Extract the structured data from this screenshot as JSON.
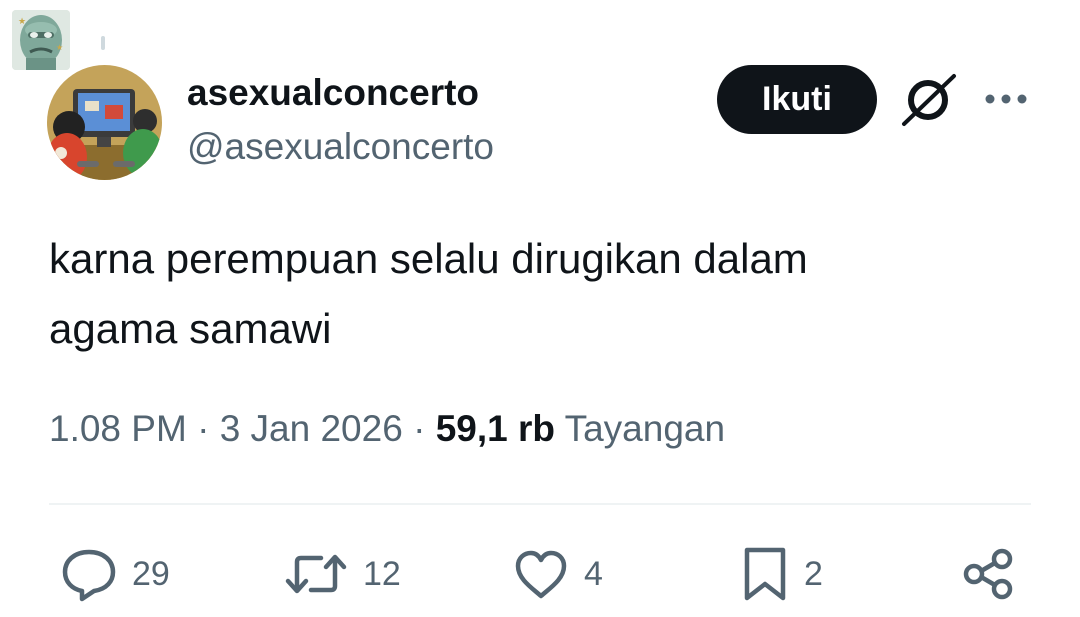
{
  "author": {
    "display_name": "asexualconcerto",
    "handle": "@asexualconcerto"
  },
  "header": {
    "follow_label": "Ikuti",
    "grok_icon": "grok-slash-circle-icon",
    "more_icon": "more-dots-icon"
  },
  "tweet": {
    "text": "karna perempuan selalu dirugikan dalam\nagama samawi",
    "time": "1.08 PM",
    "separator": "·",
    "date": "3 Jan 2026",
    "views_count": "59,1 rb",
    "views_label": "Tayangan"
  },
  "actions": {
    "reply_count": "29",
    "retweet_count": "12",
    "like_count": "4",
    "bookmark_count": "2"
  },
  "colors": {
    "text": "#0f1419",
    "secondary": "#536471",
    "divider": "#eff3f4",
    "button": "#0f1419"
  }
}
